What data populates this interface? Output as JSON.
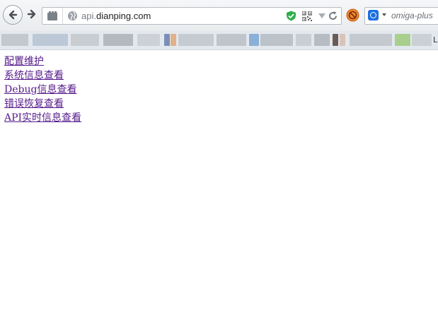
{
  "browser": {
    "url_prefix": "api.",
    "url_domain": "dianping.com",
    "search_addon_label": "omiga-plus",
    "icons": {
      "back": "back-arrow-icon",
      "forward": "forward-arrow-icon",
      "identity": "site-identity-icon",
      "globe": "globe-icon",
      "shield": "shield-check-icon",
      "qr": "qr-code-icon",
      "dropdown": "dropdown-triangle-icon",
      "reload": "reload-icon",
      "addon": "blocked-addon-icon",
      "omega": "omega-logo-icon"
    },
    "bookmarks_trailing_char": "L"
  },
  "page": {
    "links": [
      {
        "label": "配置维护"
      },
      {
        "label": "系统信息查看"
      },
      {
        "label": "Debug信息查看"
      },
      {
        "label": "错误恢复查看"
      },
      {
        "label": "API实时信息查看"
      }
    ],
    "link_color": "#551a8b"
  }
}
